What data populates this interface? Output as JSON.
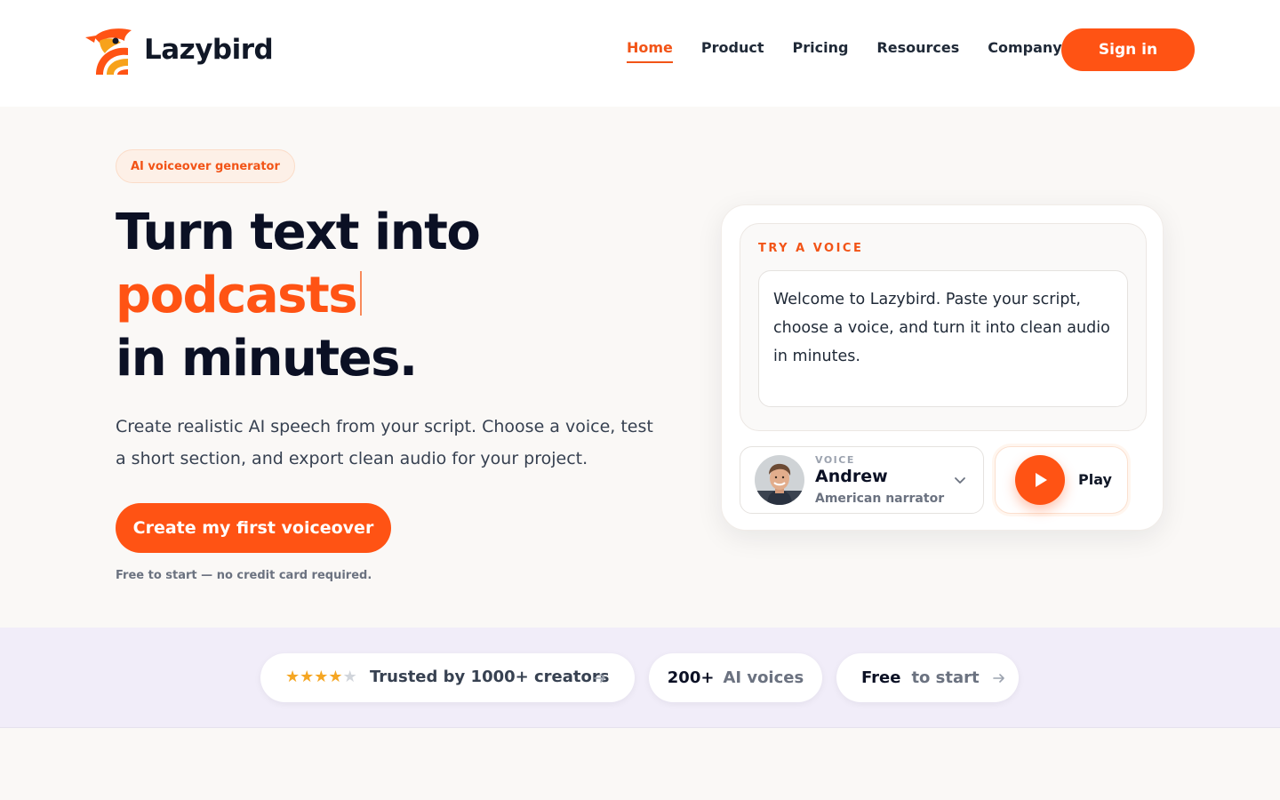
{
  "brand": {
    "name": "Lazybird",
    "accent_color": "#ff5314"
  },
  "nav": {
    "items": [
      {
        "label": "Home",
        "active": true
      },
      {
        "label": "Product",
        "active": false
      },
      {
        "label": "Pricing",
        "active": false
      },
      {
        "label": "Resources",
        "active": false
      },
      {
        "label": "Company",
        "active": false
      }
    ],
    "signin_label": "Sign in"
  },
  "hero": {
    "badge": "AI voiceover generator",
    "headline_line1": "Turn text into",
    "headline_accent": "podcasts",
    "headline_line3": "in minutes.",
    "subtitle": "Create realistic AI speech from your script. Choose a voice, test a short section, and export clean audio for your project.",
    "cta_label": "Create my first voiceover",
    "cta_note": "Free to start — no credit card required."
  },
  "demo": {
    "title": "TRY A VOICE",
    "script_text": "Welcome to Lazybird. Paste your script, choose a voice, and turn it into clean audio in minutes.",
    "voice_label": "VOICE",
    "voice_name": "Andrew",
    "voice_desc": "American narrator",
    "play_label": "Play"
  },
  "trust": {
    "rating_stars": 4.5,
    "creators_text": "Trusted by 1000+ creators",
    "voices_count": "200+",
    "voices_text": "AI voices",
    "free_strong": "Free",
    "free_text": "to start"
  },
  "icons": {
    "logo": "bird-logo-icon",
    "chevron": "chevron-down-icon",
    "play": "play-icon",
    "arrow": "arrow-right-icon",
    "star": "star-icon"
  }
}
